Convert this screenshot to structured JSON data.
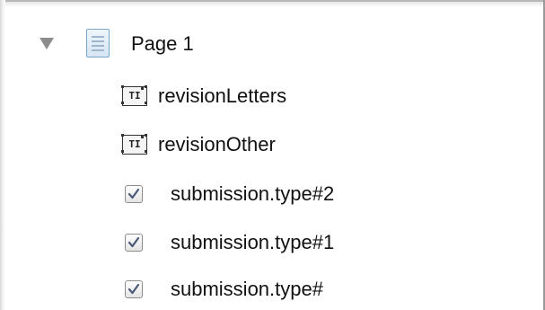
{
  "tree": {
    "root": {
      "label": "Page 1",
      "expanded": true,
      "icon": "page-icon"
    },
    "children": [
      {
        "label": "revisionLetters",
        "icon": "text-field-icon",
        "icon_text": "TI"
      },
      {
        "label": "revisionOther",
        "icon": "text-field-icon",
        "icon_text": "TI"
      },
      {
        "label": "submission.type#2",
        "icon": "checkbox-icon",
        "checked": true
      },
      {
        "label": "submission.type#1",
        "icon": "checkbox-icon",
        "checked": true
      },
      {
        "label": "submission.type#",
        "icon": "checkbox-icon",
        "checked": true
      }
    ]
  },
  "colors": {
    "disclosure": "#8c8c8c",
    "page_icon_border": "#7aa6c8",
    "checkmark": "#4a5a78"
  }
}
